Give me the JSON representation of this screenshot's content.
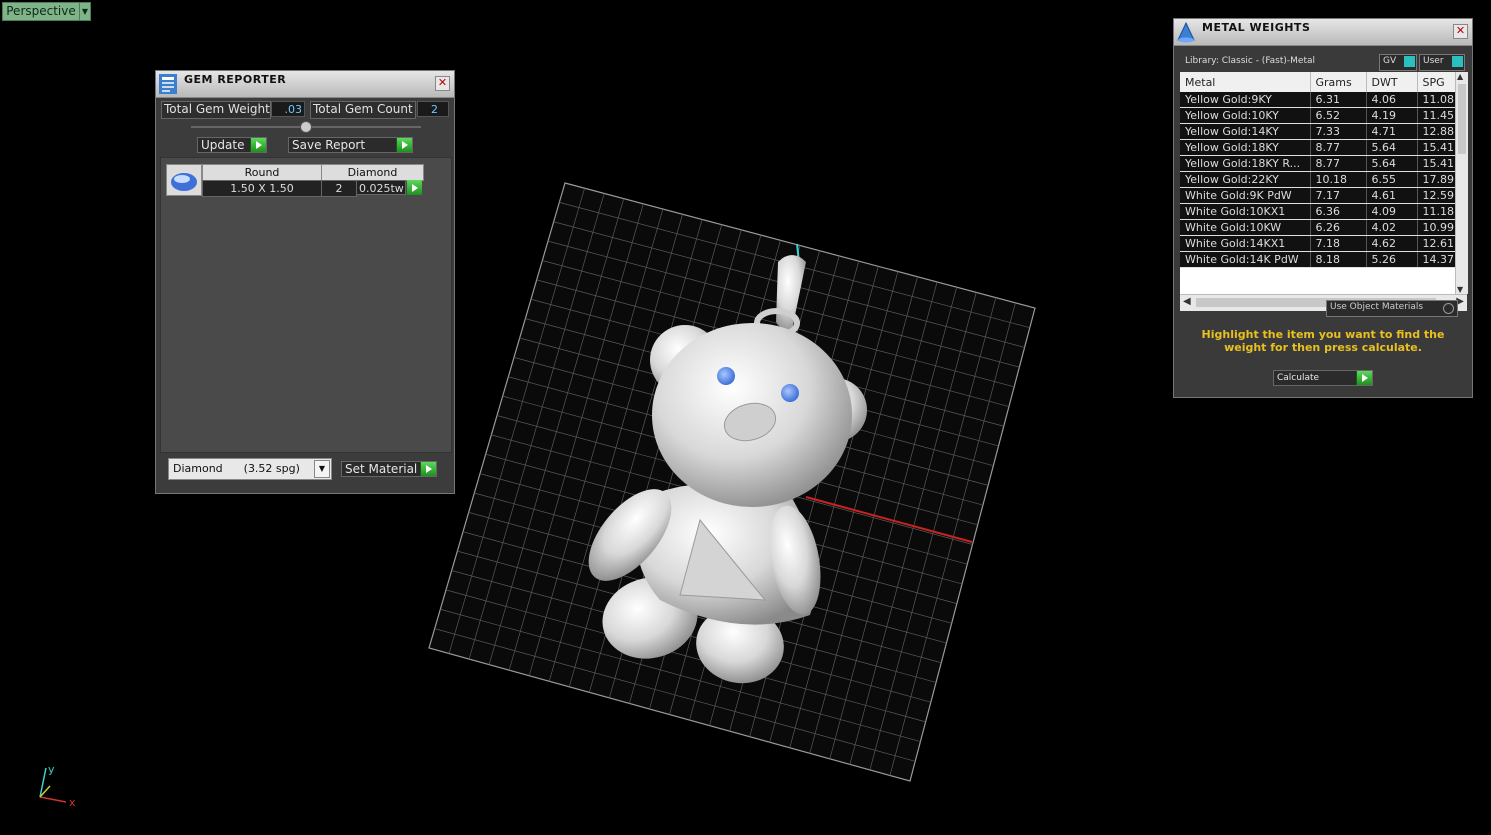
{
  "viewport": {
    "view_name": "Perspective"
  },
  "axes": {
    "y_label": "y",
    "x_label": "x"
  },
  "gem_reporter": {
    "title": "GEM REPORTER",
    "total_weight_label": "Total Gem Weight",
    "total_weight_value": ".03",
    "total_count_label": "Total Gem Count",
    "total_count_value": "2",
    "update_label": "Update",
    "save_report_label": "Save Report",
    "gem_row": {
      "shape": "Round",
      "material": "Diamond",
      "size": "1.50 X 1.50",
      "count": "2",
      "weight": "0.025tw"
    },
    "material_select": "Diamond      (3.52 spg)",
    "set_material_label": "Set Material"
  },
  "metal_weights": {
    "title": "METAL WEIGHTS",
    "library": "Library: Classic - (Fast)-Metal",
    "gv_label": "GV",
    "user_label": "User",
    "columns": [
      "Metal",
      "Grams",
      "DWT",
      "SPG"
    ],
    "rows": [
      [
        "Yellow Gold:9KY",
        "6.31",
        "4.06",
        "11.08"
      ],
      [
        "Yellow Gold:10KY",
        "6.52",
        "4.19",
        "11.45"
      ],
      [
        "Yellow Gold:14KY",
        "7.33",
        "4.71",
        "12.88"
      ],
      [
        "Yellow Gold:18KY",
        "8.77",
        "5.64",
        "15.41"
      ],
      [
        "Yellow Gold:18KY R...",
        "8.77",
        "5.64",
        "15.41"
      ],
      [
        "Yellow Gold:22KY",
        "10.18",
        "6.55",
        "17.89"
      ],
      [
        "White Gold:9K PdW",
        "7.17",
        "4.61",
        "12.59"
      ],
      [
        "White Gold:10KX1",
        "6.36",
        "4.09",
        "11.18"
      ],
      [
        "White Gold:10KW",
        "6.26",
        "4.02",
        "10.99"
      ],
      [
        "White Gold:14KX1",
        "7.18",
        "4.62",
        "12.61"
      ],
      [
        "White Gold:14K PdW",
        "8.18",
        "5.26",
        "14.37"
      ]
    ],
    "use_object_label": "Use Object Materials",
    "hint": "Highlight the item you want to find the weight for then press calculate.",
    "calculate_label": "Calculate"
  }
}
